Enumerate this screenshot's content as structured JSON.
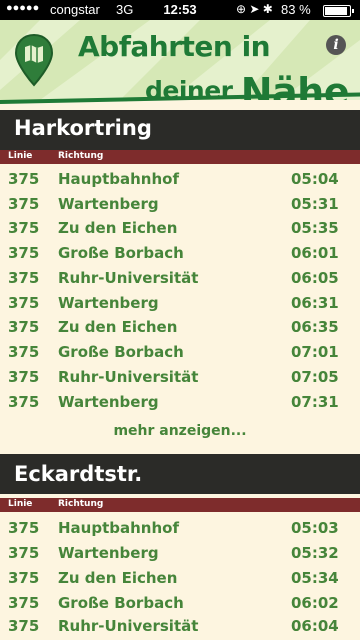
{
  "status_bar": {
    "signal": "●●●●●",
    "carrier": "congstar",
    "network": "3G",
    "time": "12:53",
    "icons": "⊕ ➤ ✱",
    "battery_pct": "83 %",
    "battery_level": 0.83
  },
  "header": {
    "title_line1": "Abfahrten in",
    "title_line2_a": "deiner ",
    "title_line2_b": "Nähe",
    "info": "i"
  },
  "columns": {
    "line": "Linie",
    "direction": "Richtung"
  },
  "stops": [
    {
      "name": "Harkortring",
      "departures": [
        {
          "line": "375",
          "direction": "Hauptbahnhof",
          "time": "05:04"
        },
        {
          "line": "375",
          "direction": "Wartenberg",
          "time": "05:31"
        },
        {
          "line": "375",
          "direction": "Zu den Eichen",
          "time": "05:35"
        },
        {
          "line": "375",
          "direction": "Große Borbach",
          "time": "06:01"
        },
        {
          "line": "375",
          "direction": "Ruhr-Universität",
          "time": "06:05"
        },
        {
          "line": "375",
          "direction": "Wartenberg",
          "time": "06:31"
        },
        {
          "line": "375",
          "direction": "Zu den Eichen",
          "time": "06:35"
        },
        {
          "line": "375",
          "direction": "Große Borbach",
          "time": "07:01"
        },
        {
          "line": "375",
          "direction": "Ruhr-Universität",
          "time": "07:05"
        },
        {
          "line": "375",
          "direction": "Wartenberg",
          "time": "07:31"
        }
      ],
      "more": "mehr anzeigen..."
    },
    {
      "name": "Eckardtstr.",
      "departures": [
        {
          "line": "375",
          "direction": "Hauptbahnhof",
          "time": "05:03"
        },
        {
          "line": "375",
          "direction": "Wartenberg",
          "time": "05:32"
        },
        {
          "line": "375",
          "direction": "Zu den Eichen",
          "time": "05:34"
        },
        {
          "line": "375",
          "direction": "Große Borbach",
          "time": "06:02"
        },
        {
          "line": "375",
          "direction": "Ruhr-Universität",
          "time": "06:04"
        }
      ]
    }
  ],
  "colors": {
    "background": "#fdf5e0",
    "accent_green": "#1f7a36",
    "row_text": "#46853a",
    "section_bar": "#2b2b28",
    "column_header": "#7e2c2c"
  }
}
